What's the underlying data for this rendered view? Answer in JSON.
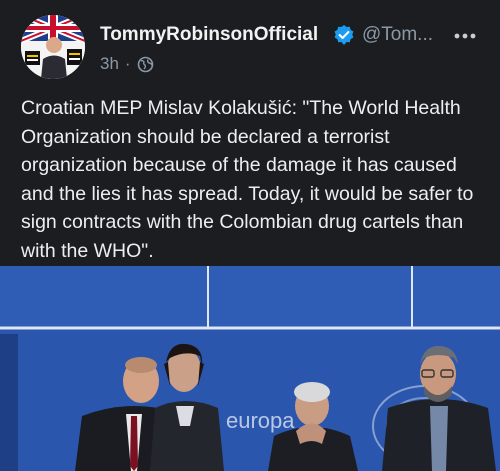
{
  "author": {
    "name": "TommyRobinsonOfficial",
    "handle": "@Tom...",
    "verified": true,
    "avatar_icon": "profile-photo-icon",
    "verified_icon": "verified-badge-icon"
  },
  "meta": {
    "time": "3h",
    "separator": "·",
    "visibility_icon": "globe-icon"
  },
  "menu": {
    "icon": "more-options-icon"
  },
  "post": {
    "text": "Croatian MEP Mislav Kolakušić: \"The World Health Organization should be declared a terrorist organization because of the damage it has caused and the lies it has spread. Today, it would be safer to sign contracts with the Colombian drug cartels than with the WHO\"."
  },
  "media": {
    "type": "video-still",
    "backdrop_text": "europa",
    "colors": {
      "backdrop": "#2a54a8",
      "panel_line": "#dfe6f4",
      "suit": "#1a1c22"
    }
  },
  "colors": {
    "background": "#1b1d21",
    "text": "#eceff1",
    "muted": "#8b98a5",
    "verified": "#1d9bf0"
  }
}
